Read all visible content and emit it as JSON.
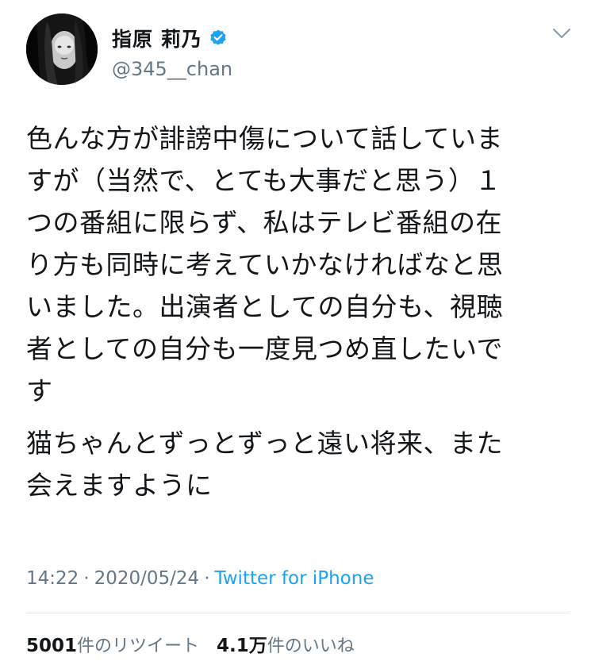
{
  "user": {
    "display_name": "指原 莉乃",
    "handle": "@345__chan",
    "verified": true,
    "avatar_icon": "profile-photo"
  },
  "header": {
    "menu_icon": "chevron-down-icon"
  },
  "tweet": {
    "paragraphs": [
      "色んな方が誹謗中傷について話していま\nすが（当然で、とても大事だと思う）１\nつの番組に限らず、私はテレビ番組の在\nり方も同時に考えていかなければなと思\nいました。出演者としての自分も、視聴\n者としての自分も一度見つめ直したいで\nす",
      "猫ちゃんとずっとずっと遠い将来、また\n会えますように"
    ]
  },
  "meta": {
    "time": "14:22",
    "date": "2020/05/24",
    "separator": "·",
    "source": "Twitter for iPhone"
  },
  "stats": {
    "retweets_count": "5001",
    "retweets_label": "件のリツイート",
    "likes_count": "4.1万",
    "likes_label": "件のいいね"
  },
  "colors": {
    "text": "#14171a",
    "secondary": "#657786",
    "link": "#1da1f2",
    "verified_badge": "#1da1f2",
    "divider": "#e1e8ed"
  }
}
